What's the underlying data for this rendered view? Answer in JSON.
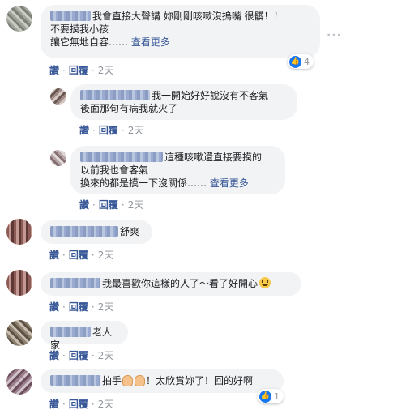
{
  "actions": {
    "like": "讚",
    "reply": "回覆",
    "separator": "·"
  },
  "comments": [
    {
      "lines": [
        "我會直接大聲講 妳剛剛咳嗽沒摀嘴 很髒！！",
        "不要摸我小孩",
        "讓它無地自容……"
      ],
      "see_more": "查看更多",
      "time": "2天",
      "reaction_count": "4"
    },
    {
      "lines": [
        "我一開始好好說沒有不客氣",
        "後面那句有病我就火了"
      ],
      "time": "2天"
    },
    {
      "lines": [
        "這種咳嗽還直接要摸的",
        "以前我也會客氣",
        "換來的都是摸一下沒關係……"
      ],
      "see_more": "查看更多",
      "time": "2天"
    },
    {
      "lines": [
        "舒爽"
      ],
      "time": "2天"
    },
    {
      "lines": [
        "我最喜歡你這樣的人了～看了好開心"
      ],
      "time": "2天"
    },
    {
      "lines": [
        "老人家"
      ],
      "time": "2天"
    },
    {
      "lines_parts": {
        "before": "拍手",
        "after": "！太欣賞妳了！回的好啊"
      },
      "time": "2天",
      "reaction_count": "1"
    }
  ],
  "icons": {
    "more": "more-options-icon",
    "like": "like-reaction-icon",
    "smile": "smile-emoji-icon",
    "clap": "clap-emoji-icon"
  },
  "colors": {
    "link": "#385898",
    "bubble": "#f2f3f5",
    "like_blue": "#1877f2",
    "meta_gray": "#90949c"
  }
}
